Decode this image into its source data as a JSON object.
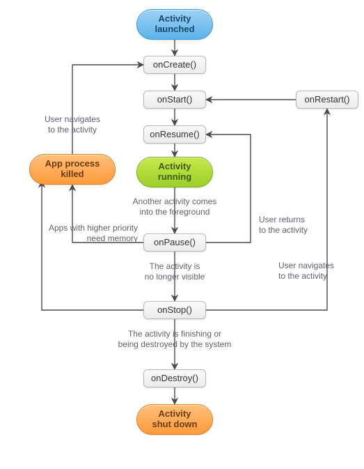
{
  "nodes": {
    "launched": "Activity\nlaunched",
    "onCreate": "onCreate()",
    "onStart": "onStart()",
    "onResume": "onResume()",
    "running": "Activity\nrunning",
    "onPause": "onPause()",
    "onStop": "onStop()",
    "onDestroy": "onDestroy()",
    "shutdown": "Activity\nshut down",
    "killed": "App process\nkilled",
    "onRestart": "onRestart()"
  },
  "labels": {
    "killed_to_create": "User navigates\nto the activity",
    "pause_to_killed": "Apps with higher priority\nneed memory",
    "running_to_pause": "Another activity comes\ninto the foreground",
    "pause_to_stop": "The activity is\nno longer visible",
    "stop_to_destroy": "The activity is finishing or\nbeing destroyed by the system",
    "pause_to_resume": "User returns\nto the activity",
    "stop_to_restart": "User navigates\nto the activity"
  },
  "edges": [
    {
      "from": "launched",
      "to": "onCreate"
    },
    {
      "from": "onCreate",
      "to": "onStart"
    },
    {
      "from": "onStart",
      "to": "onResume"
    },
    {
      "from": "onResume",
      "to": "running"
    },
    {
      "from": "running",
      "to": "onPause",
      "label_key": "running_to_pause"
    },
    {
      "from": "onPause",
      "to": "onStop",
      "label_key": "pause_to_stop"
    },
    {
      "from": "onStop",
      "to": "onDestroy",
      "label_key": "stop_to_destroy"
    },
    {
      "from": "onDestroy",
      "to": "shutdown"
    },
    {
      "from": "onPause",
      "to": "killed",
      "label_key": "pause_to_killed"
    },
    {
      "from": "onStop",
      "to": "killed"
    },
    {
      "from": "killed",
      "to": "onCreate",
      "label_key": "killed_to_create"
    },
    {
      "from": "onPause",
      "to": "onResume",
      "label_key": "pause_to_resume"
    },
    {
      "from": "onStop",
      "to": "onRestart",
      "label_key": "stop_to_restart"
    },
    {
      "from": "onRestart",
      "to": "onStart"
    }
  ],
  "colors": {
    "start": "#5bb3ea",
    "running": "#9dcf2a",
    "terminal": "#ff9a3c",
    "box_bg": "#ececec",
    "box_border": "#b8b8b8",
    "arrow": "#4a4a4a",
    "text": "#333333",
    "label_text": "#5f6368"
  }
}
